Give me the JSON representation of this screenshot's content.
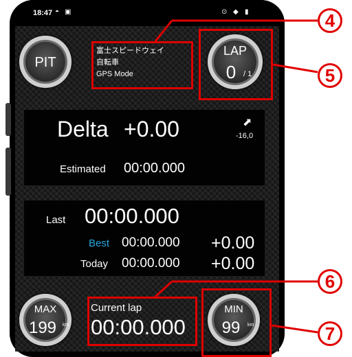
{
  "status": {
    "time": "18:47"
  },
  "pit": {
    "label": "PIT"
  },
  "track_info": {
    "name": "富士スピードウェイ",
    "vehicle": "自転車",
    "mode": "GPS Mode"
  },
  "lap": {
    "label": "LAP",
    "current": "0",
    "total": "/ 1"
  },
  "delta": {
    "label": "Delta",
    "value": "+0.00",
    "arrow_value": "-16,0"
  },
  "estimated": {
    "label": "Estimated",
    "value": "00:00.000"
  },
  "last": {
    "label": "Last",
    "value": "00:00.000"
  },
  "best": {
    "label": "Best",
    "time": "00:00.000",
    "diff": "+0.00"
  },
  "today": {
    "label": "Today",
    "time": "00:00.000",
    "diff": "+0.00"
  },
  "max": {
    "label": "MAX",
    "value": "199",
    "unit": "km"
  },
  "current_lap": {
    "label": "Current lap",
    "value": "00:00.000"
  },
  "min": {
    "label": "MIN",
    "value": "99",
    "unit": "km"
  },
  "callouts": {
    "c4": "4",
    "c5": "5",
    "c6": "6",
    "c7": "7"
  },
  "colors": {
    "accent_red": "#e00000",
    "best_blue": "#2aa7e0"
  }
}
